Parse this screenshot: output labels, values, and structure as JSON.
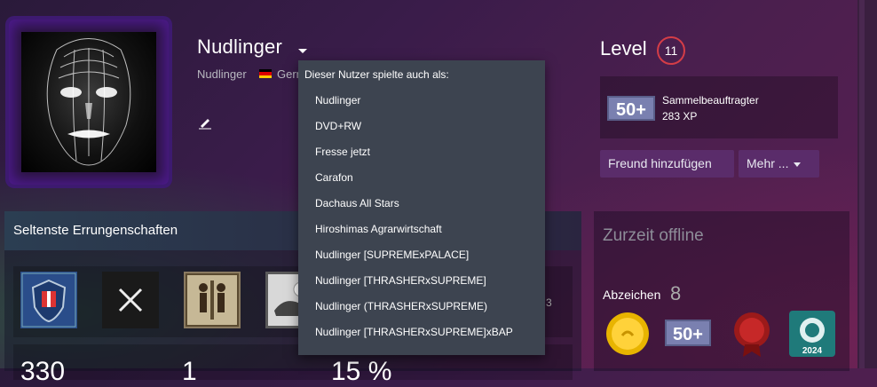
{
  "profile": {
    "persona_name": "Nudlinger",
    "real_name": "Nudlinger",
    "country_partial": "Gerr"
  },
  "aliases_menu": {
    "title": "Dieser Nutzer spielte auch als:",
    "items": [
      "Nudlinger",
      "DVD+RW",
      "Fresse jetzt",
      "Carafon",
      "Dachaus All Stars",
      "Hiroshimas Agrarwirtschaft",
      "Nudlinger [SUPREMExPALACE]",
      "Nudlinger [THRASHERxSUPREME]",
      "Nudlinger (THRASHERxSUPREME)",
      "Nudlinger [THRASHERxSUPREME]xBAP"
    ]
  },
  "level": {
    "label": "Level",
    "value": "11",
    "badge_name": "Sammelbeauftragter",
    "xp": "283 XP",
    "badge_icon_text": "50+"
  },
  "actions": {
    "add_friend": "Freund hinzufügen",
    "more": "Mehr ..."
  },
  "achievements": {
    "title": "Seltenste Errungenschaften",
    "partial_digit": "3",
    "stats": [
      "330",
      "1",
      "15 %"
    ]
  },
  "status": {
    "text": "Zurzeit offline",
    "badges_label": "Abzeichen",
    "badges_count": "8",
    "steam_badge_year": "2024",
    "badge_50_text": "50+"
  },
  "colors": {
    "level_ring": "#d43d47",
    "button_bg": "#5a2c6a",
    "menu_bg": "#3d4450"
  }
}
